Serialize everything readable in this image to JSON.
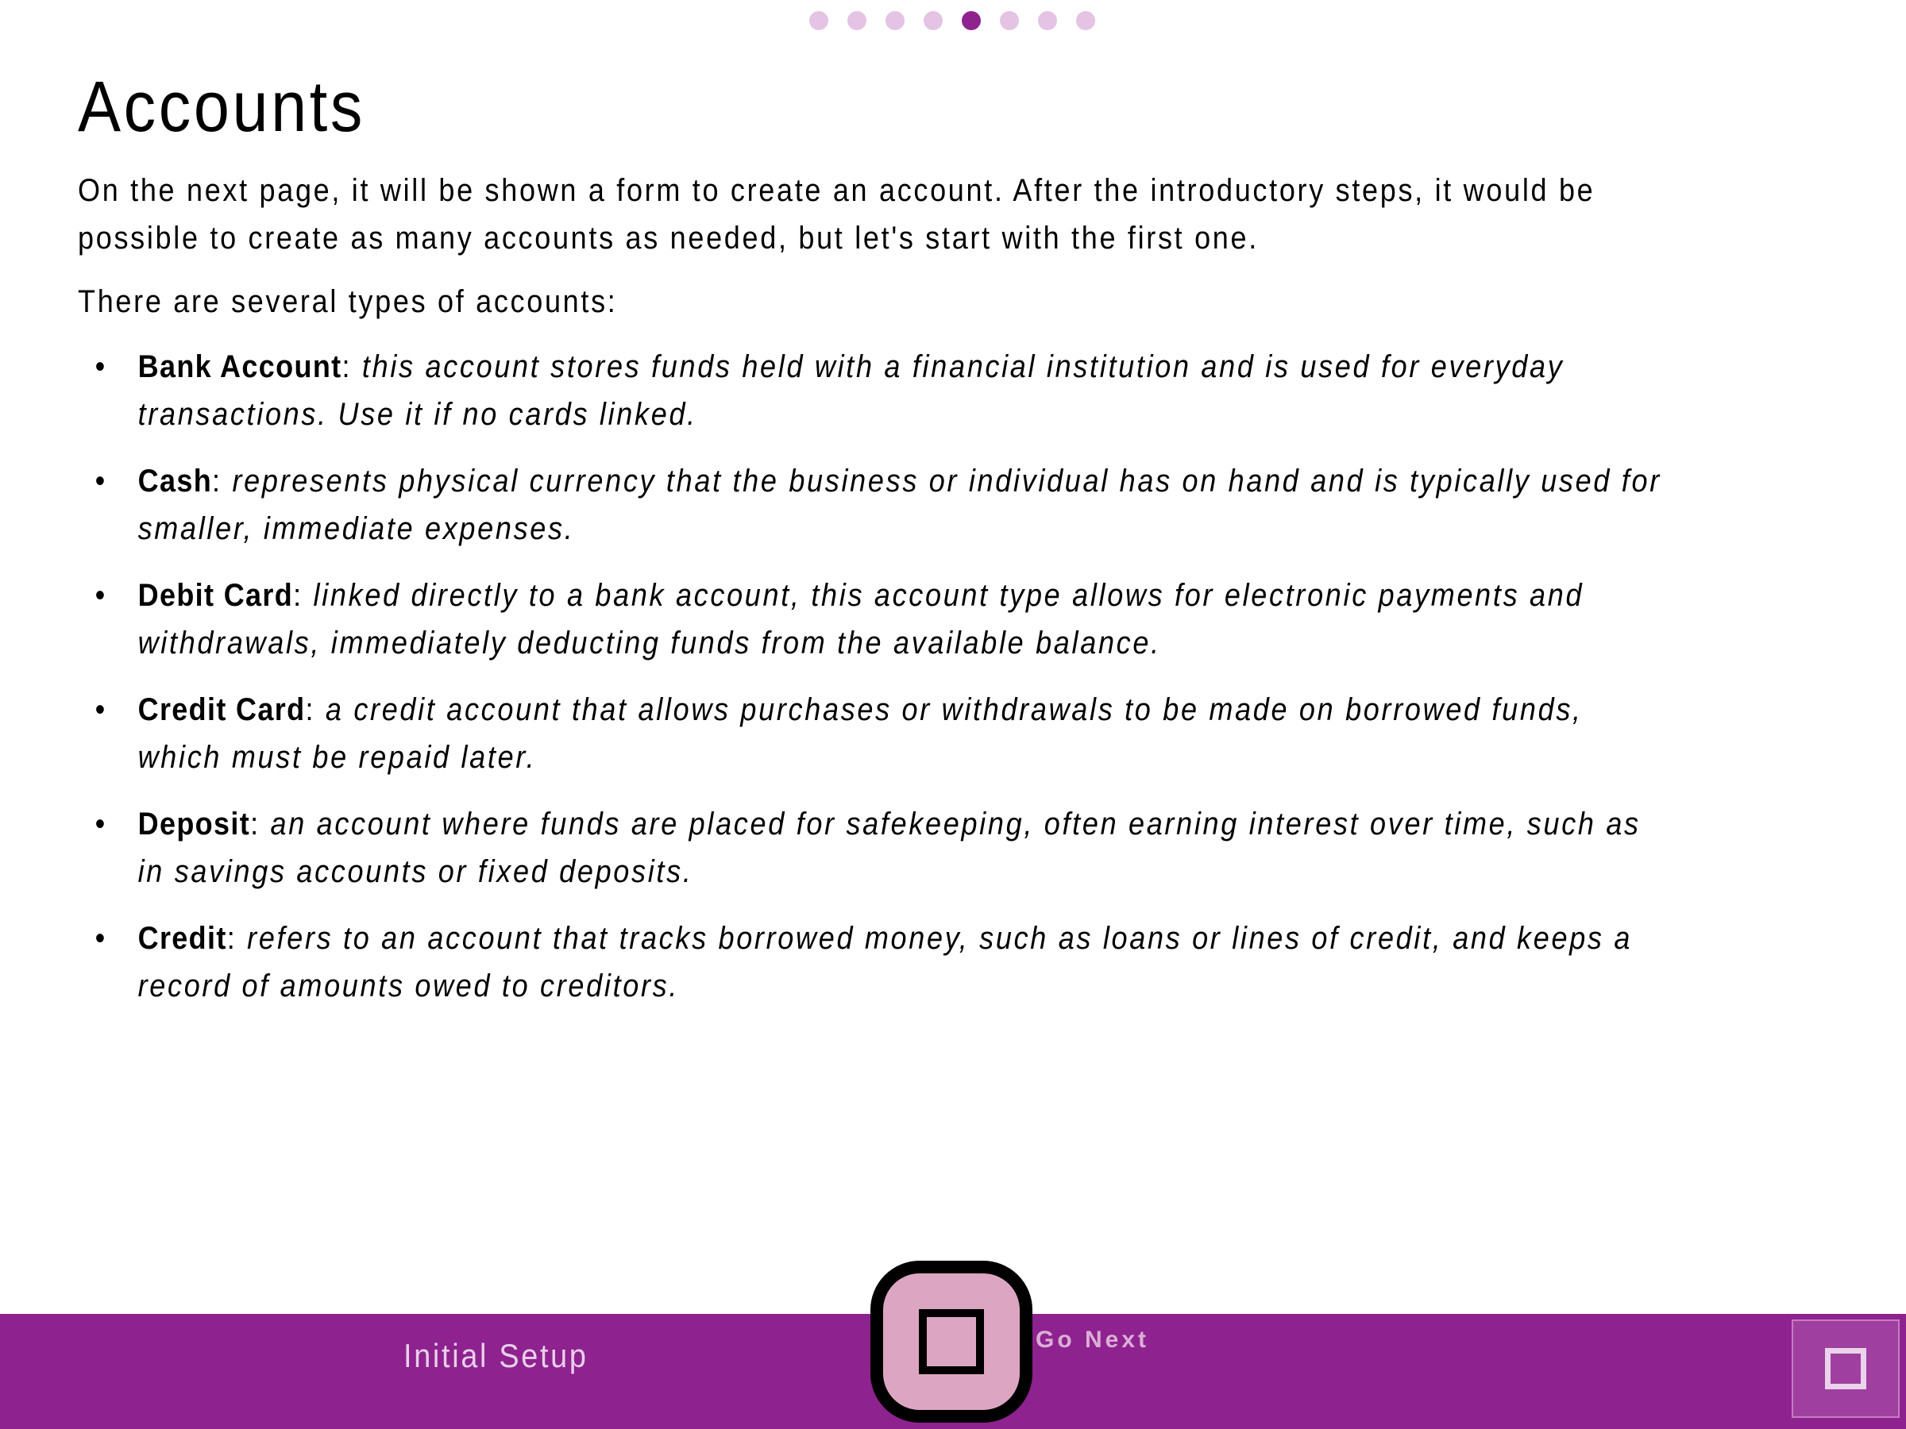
{
  "pager": {
    "total": 8,
    "current_index": 4,
    "active_color": "#8e228f",
    "inactive_color": "#e4c3e4"
  },
  "page": {
    "title": "Accounts",
    "intro": "On the next page, it will be shown a form to create an account. After the introductory steps, it would be possible to create as many accounts as needed, but let's start with the first one.",
    "types_heading": "There are several types of accounts:",
    "account_types": [
      {
        "term": "Bank Account",
        "description": "this account stores funds held with a financial institution and is used for everyday transactions. Use it if no cards linked."
      },
      {
        "term": "Cash",
        "description": "represents physical currency that the business or individual has on hand and is typically used for smaller, immediate expenses."
      },
      {
        "term": "Debit Card",
        "description": "linked directly to a bank account, this account type allows for electronic payments and withdrawals, immediately deducting funds from the available balance."
      },
      {
        "term": "Credit Card",
        "description": "a credit account that allows purchases or withdrawals to be made on borrowed funds, which must be repaid later."
      },
      {
        "term": "Deposit",
        "description": "an account where funds are placed for safekeeping, often earning interest over time, such as in savings accounts or fixed deposits."
      },
      {
        "term": "Credit",
        "description": "refers to an account that tracks borrowed money, such as loans or lines of credit, and keeps a record of amounts owed to creditors."
      }
    ]
  },
  "footer": {
    "title": "Initial Setup",
    "next_label": "Go Next",
    "bar_color": "#8e228f",
    "center_button_icon": "square-icon",
    "corner_button_icon": "square-icon"
  }
}
